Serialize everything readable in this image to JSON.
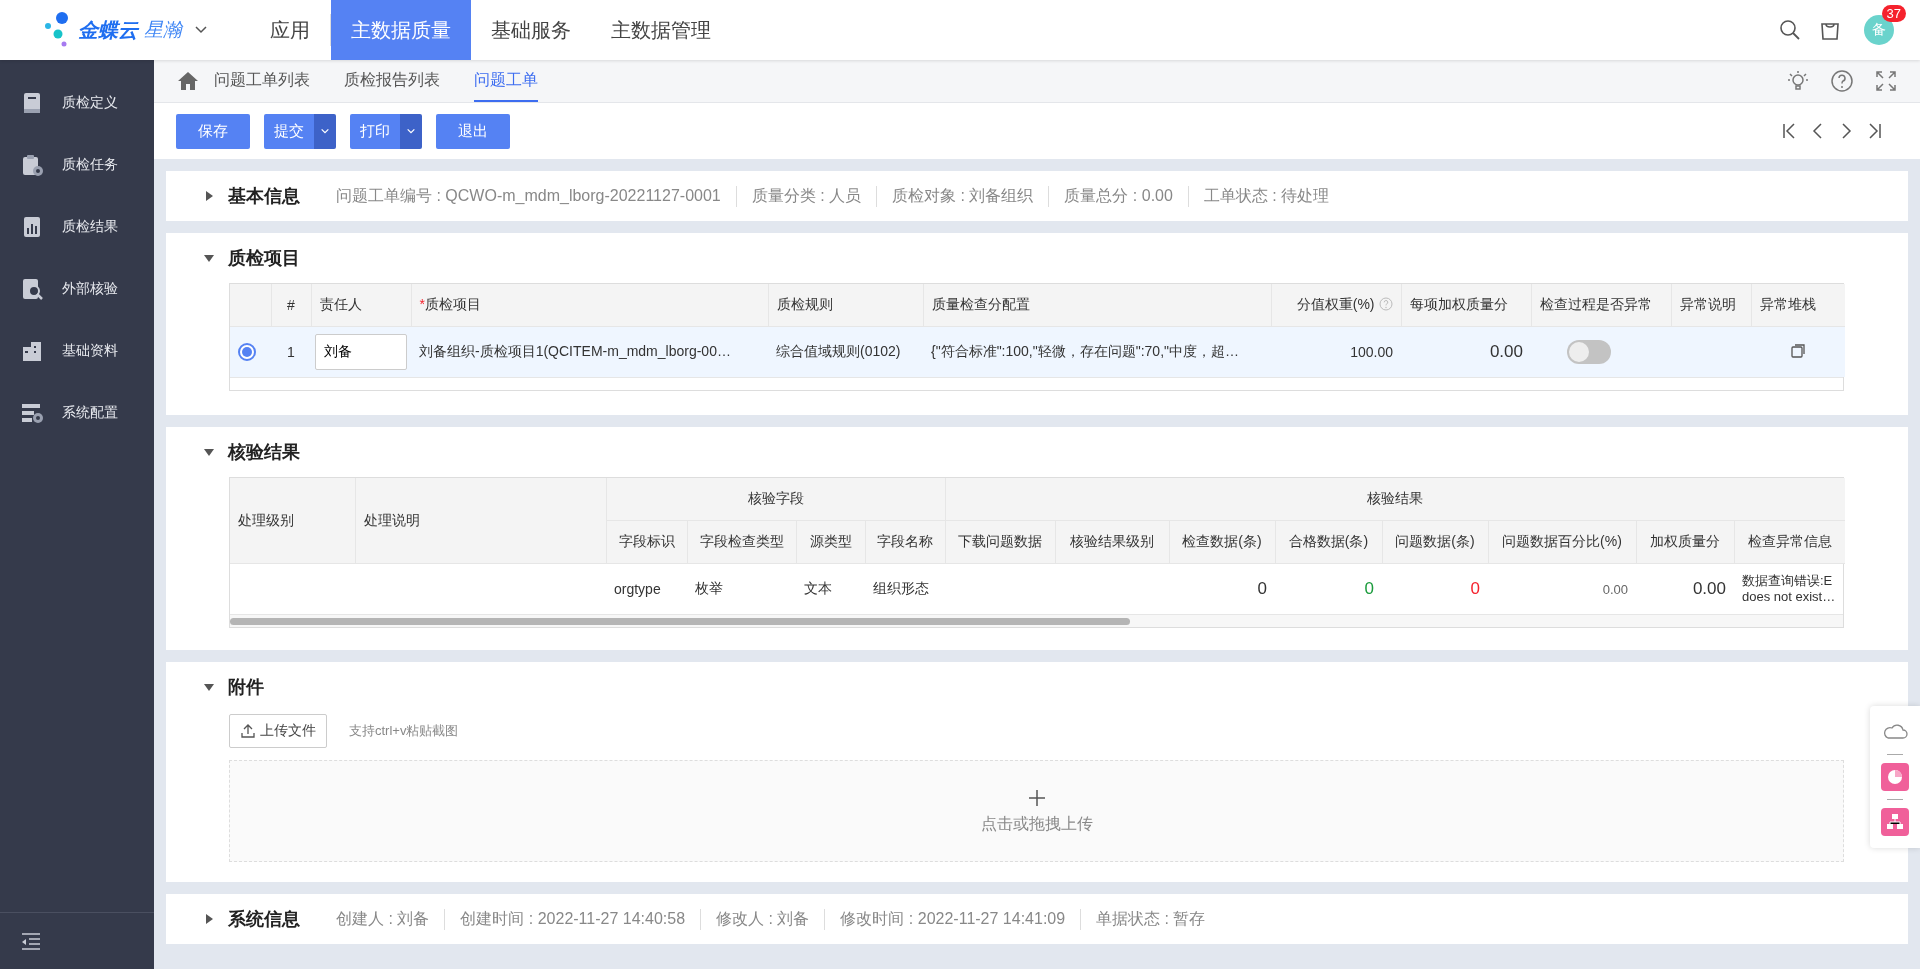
{
  "header": {
    "logo": {
      "brand": "金蝶云",
      "product": "星瀚"
    },
    "nav": [
      {
        "label": "应用",
        "selected": false
      },
      {
        "label": "主数据质量",
        "selected": true
      },
      {
        "label": "基础服务",
        "selected": false
      },
      {
        "label": "主数据管理",
        "selected": false
      }
    ],
    "avatar": "备",
    "badge": "37"
  },
  "sidebar": {
    "items": [
      {
        "label": "质检定义"
      },
      {
        "label": "质检任务"
      },
      {
        "label": "质检结果"
      },
      {
        "label": "外部核验"
      },
      {
        "label": "基础资料"
      },
      {
        "label": "系统配置"
      }
    ]
  },
  "breadcrumbs": [
    {
      "label": "问题工单列表",
      "selected": false
    },
    {
      "label": "质检报告列表",
      "selected": false
    },
    {
      "label": "问题工单",
      "selected": true
    }
  ],
  "toolbar": {
    "buttons": [
      {
        "label": "保存",
        "kind": "plain"
      },
      {
        "label": "提交",
        "kind": "split"
      },
      {
        "label": "打印",
        "kind": "split"
      },
      {
        "label": "退出",
        "kind": "plain"
      }
    ]
  },
  "basic_info": {
    "title": "基本信息",
    "expanded": false,
    "fields": [
      "问题工单编号 : QCWO-m_mdm_lborg-20221127-0001",
      "质量分类 : 人员",
      "质检对象 : 刘备组织",
      "质量总分 : 0.00",
      "工单状态 : 待处理"
    ]
  },
  "quality_items": {
    "title": "质检项目",
    "expanded": true,
    "columns": [
      {
        "label": "#"
      },
      {
        "label": "责任人"
      },
      {
        "label": "质检项目",
        "mark": "*"
      },
      {
        "label": "质检规则"
      },
      {
        "label": "质量检查分配置"
      },
      {
        "label": "分值权重(%)",
        "help": true
      },
      {
        "label": "每项加权质量分"
      },
      {
        "label": "检查过程是否异常"
      },
      {
        "label": "异常说明"
      },
      {
        "label": "异常堆栈"
      }
    ],
    "rows": [
      {
        "selected": true,
        "index": "1",
        "owner": "刘备",
        "item": "刘备组织-质检项目1(QCITEM-m_mdm_lborg-00…",
        "rule": "综合值域规则(0102)",
        "config": "{\"符合标准\":100,\"轻微，存在问题\":70,\"中度，超…",
        "weight": "100.00",
        "score": "0.00",
        "abnormal": false
      }
    ]
  },
  "check_results": {
    "title": "核验结果",
    "expanded": true,
    "single_columns": [
      "处理级别",
      "处理说明"
    ],
    "groups": [
      {
        "label": "核验字段",
        "columns": [
          "字段标识",
          "字段检查类型",
          "源类型",
          "字段名称"
        ]
      },
      {
        "label": "核验结果",
        "columns": [
          "下载问题数据",
          "核验结果级别",
          "检查数据(条)",
          "合格数据(条)",
          "问题数据(条)",
          "问题数据百分比(%)",
          "加权质量分",
          "检查异常信息"
        ]
      }
    ],
    "rows": [
      {
        "cells": [
          {},
          {},
          {
            "text": "orgtype"
          },
          {
            "text": "枚举"
          },
          {
            "text": "文本"
          },
          {
            "text": "组织形态"
          },
          {},
          {},
          {
            "text": "0",
            "kind": "big"
          },
          {
            "text": "0",
            "kind": "big",
            "color": "#1a9b3c"
          },
          {
            "text": "0",
            "kind": "big",
            "color": "#f5222d"
          },
          {
            "text": "0.00",
            "kind": "small"
          },
          {
            "text": "0.00",
            "kind": "big"
          },
          {
            "lines": [
              "数据查询错误:E",
              "does not exist…"
            ]
          }
        ]
      }
    ]
  },
  "attachments": {
    "title": "附件",
    "expanded": true,
    "upload_button": "上传文件",
    "hint": "支持ctrl+v粘贴截图",
    "drop_text": "点击或拖拽上传"
  },
  "system_info": {
    "title": "系统信息",
    "expanded": false,
    "fields": [
      "创建人 : 刘备",
      "创建时间 : 2022-11-27 14:40:58",
      "修改人 : 刘备",
      "修改时间 : 2022-11-27 14:41:09",
      "单据状态 : 暂存"
    ]
  }
}
